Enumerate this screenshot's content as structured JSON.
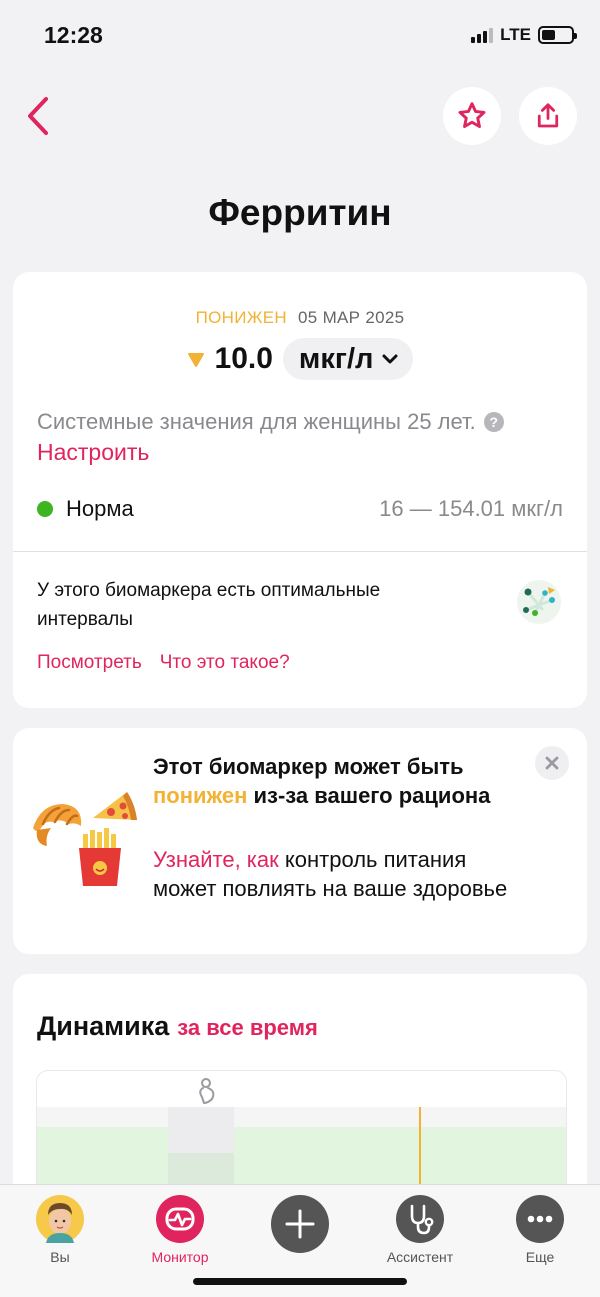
{
  "status_bar": {
    "time": "12:28",
    "network": "LTE",
    "battery_level": 0.5
  },
  "header": {
    "back_icon": "chevron-left-icon",
    "favorite_icon": "star-icon",
    "share_icon": "share-icon",
    "title": "Ферритин"
  },
  "result": {
    "status": "ПОНИЖЕН",
    "date": "05 МАР 2025",
    "value": "10.0",
    "unit": "мкг/л",
    "system_text": "Системные значения для женщины 25 лет.",
    "configure_link": "Настроить",
    "norm_label": "Норма",
    "norm_range": "16 — 154.01 мкг/л",
    "optimal_text": "У этого биомаркера есть оптимальные интервалы",
    "view_link": "Посмотреть",
    "what_link": "Что это такое?"
  },
  "diet": {
    "title_pre": "Этот биомаркер может быть ",
    "title_highlight": "понижен",
    "title_post": " из-за вашего рациона",
    "body_link": "Узнайте, как",
    "body_text": " контроль питания может повлиять на ваше здоровье"
  },
  "dynamics": {
    "title": "Динамика",
    "range": "за все время"
  },
  "tabs": [
    {
      "label": "Вы",
      "icon": "avatar"
    },
    {
      "label": "Монитор",
      "icon": "monitor-icon",
      "active": true
    },
    {
      "label": "",
      "icon": "plus-icon"
    },
    {
      "label": "Ассистент",
      "icon": "stethoscope-icon"
    },
    {
      "label": "Еще",
      "icon": "more-icon"
    }
  ],
  "colors": {
    "accent": "#e0245e",
    "low": "#f2b233",
    "normal": "#3cb521",
    "background": "#f2f2f4"
  }
}
